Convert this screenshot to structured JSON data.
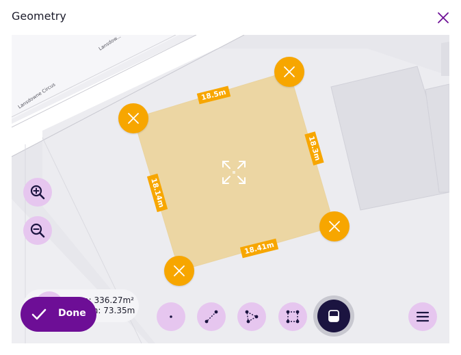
{
  "dialog": {
    "title": "Geometry",
    "close_icon": "close-icon"
  },
  "map": {
    "street_labels": [
      "Lansdowne Circus",
      "Lansdow..."
    ],
    "polygon_fill": "#ecd6a3",
    "accent_color": "#f7a600",
    "edges": [
      {
        "label": "18.5m"
      },
      {
        "label": "18.3m"
      },
      {
        "label": "18.41m"
      },
      {
        "label": "18.14m"
      }
    ],
    "vertex_icon": "close-icon",
    "center_icon": "expand-arrows-icon"
  },
  "zoom": {
    "in_icon": "zoom-in-icon",
    "out_icon": "zoom-out-icon"
  },
  "measurement": {
    "icon": "ruler-icon",
    "area": "Area: 336.27m²",
    "length": "Length: 73.35m"
  },
  "done_button": {
    "label": "Done",
    "icon": "check-icon",
    "color": "#6d0e96"
  },
  "tools": [
    {
      "name": "point",
      "icon": "point-icon"
    },
    {
      "name": "line",
      "icon": "line-icon"
    },
    {
      "name": "polygon",
      "icon": "polygon-icon"
    },
    {
      "name": "rectangle",
      "icon": "rectangle-icon"
    },
    {
      "name": "eraser",
      "icon": "eraser-icon",
      "active": true
    }
  ],
  "menu_icon": "menu-icon"
}
